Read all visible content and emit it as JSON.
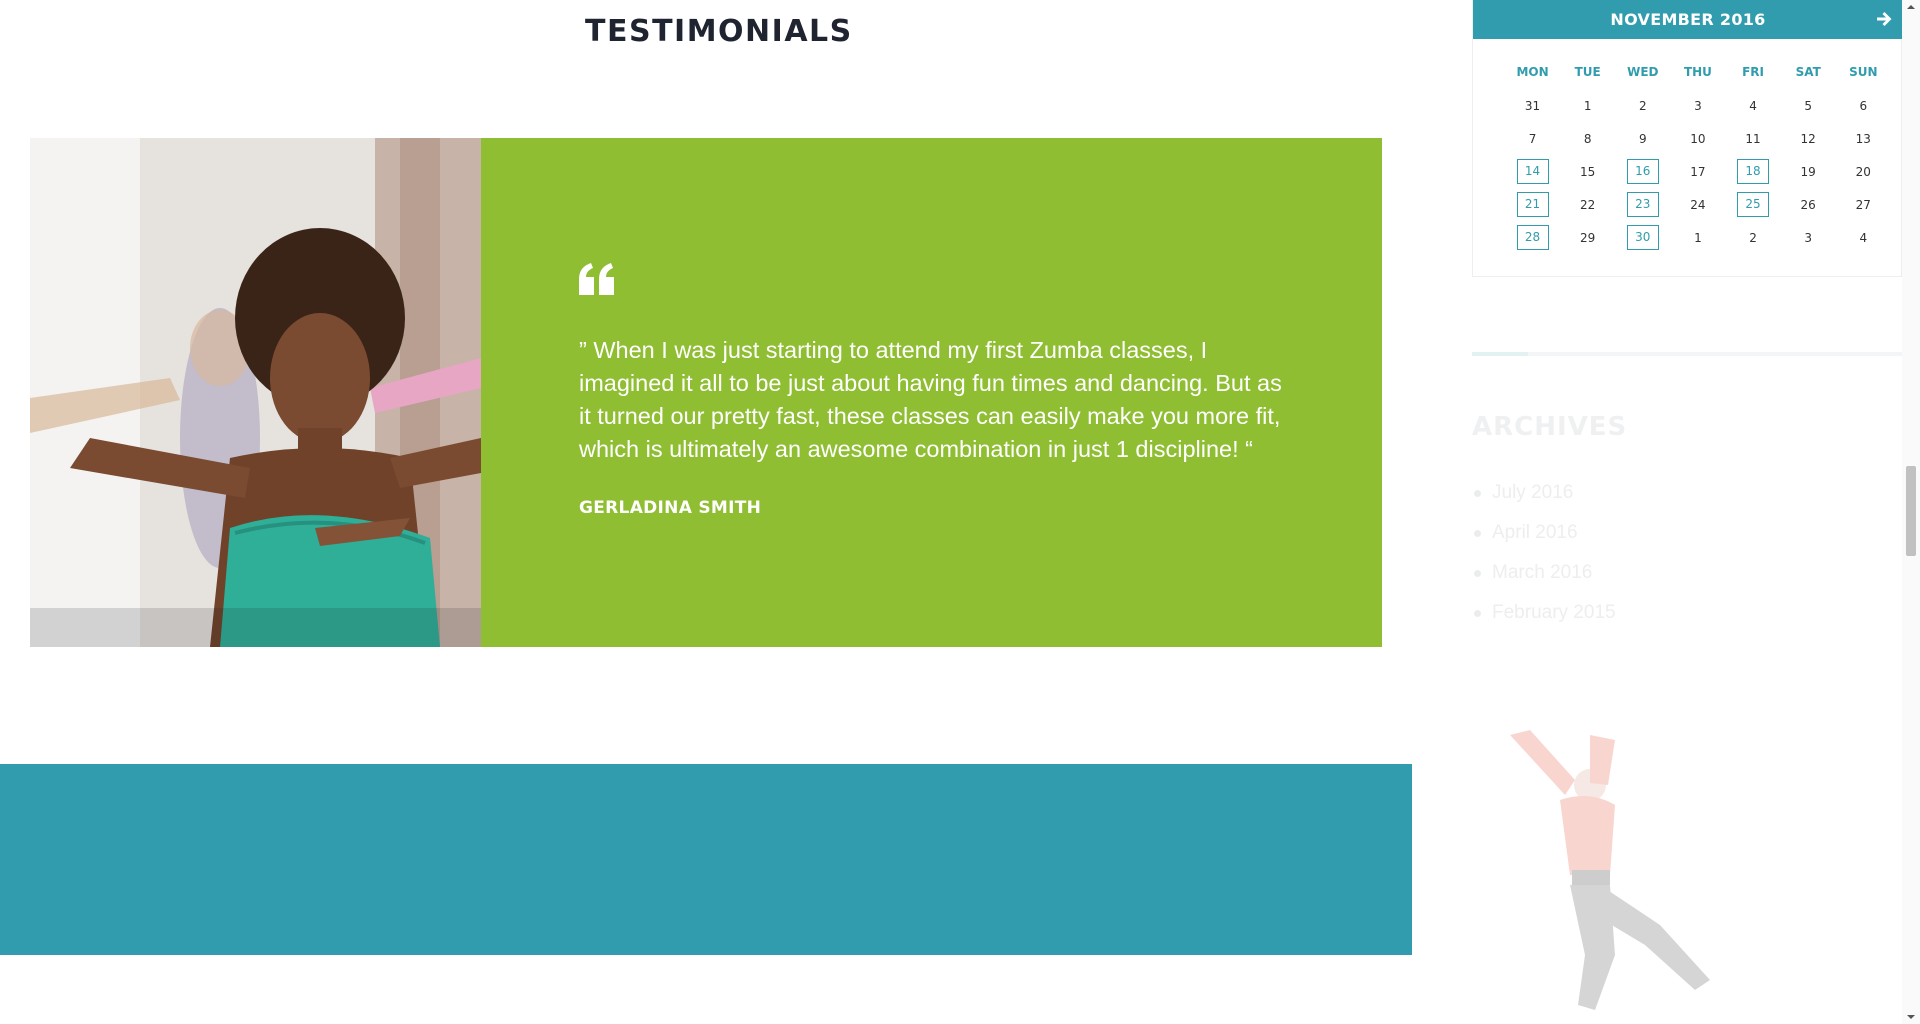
{
  "section": {
    "title": "TESTIMONIALS"
  },
  "testimonial": {
    "quote": "” When I was just starting to attend my first Zumba classes, I imagined it all to be just about having fun times and dancing. But as it turned our pretty fast, these classes can easily make you more fit, which is ultimately an awesome combination in just 1 discipline! “",
    "author": "GERLADINA SMITH",
    "panel_color": "#8fbe33",
    "quote_icon": "quote-icon"
  },
  "calendar": {
    "title": "NOVEMBER 2016",
    "next_icon": "arrow-right-icon",
    "accent_color": "#319cad",
    "weekdays": [
      "MON",
      "TUE",
      "WED",
      "THU",
      "FRI",
      "SAT",
      "SUN"
    ],
    "weeks": [
      [
        {
          "d": "31",
          "link": false
        },
        {
          "d": "1",
          "link": false
        },
        {
          "d": "2",
          "link": false
        },
        {
          "d": "3",
          "link": false
        },
        {
          "d": "4",
          "link": false
        },
        {
          "d": "5",
          "link": false
        },
        {
          "d": "6",
          "link": false
        }
      ],
      [
        {
          "d": "7",
          "link": false
        },
        {
          "d": "8",
          "link": false
        },
        {
          "d": "9",
          "link": false
        },
        {
          "d": "10",
          "link": false
        },
        {
          "d": "11",
          "link": false
        },
        {
          "d": "12",
          "link": false
        },
        {
          "d": "13",
          "link": false
        }
      ],
      [
        {
          "d": "14",
          "link": true
        },
        {
          "d": "15",
          "link": false
        },
        {
          "d": "16",
          "link": true
        },
        {
          "d": "17",
          "link": false
        },
        {
          "d": "18",
          "link": true
        },
        {
          "d": "19",
          "link": false
        },
        {
          "d": "20",
          "link": false
        }
      ],
      [
        {
          "d": "21",
          "link": true
        },
        {
          "d": "22",
          "link": false
        },
        {
          "d": "23",
          "link": true
        },
        {
          "d": "24",
          "link": false
        },
        {
          "d": "25",
          "link": true
        },
        {
          "d": "26",
          "link": false
        },
        {
          "d": "27",
          "link": false
        }
      ],
      [
        {
          "d": "28",
          "link": true
        },
        {
          "d": "29",
          "link": false
        },
        {
          "d": "30",
          "link": true
        },
        {
          "d": "1",
          "link": false
        },
        {
          "d": "2",
          "link": false
        },
        {
          "d": "3",
          "link": false
        },
        {
          "d": "4",
          "link": false
        }
      ]
    ]
  },
  "archives": {
    "title": "ARCHIVES",
    "items": [
      "July 2016",
      "April 2016",
      "March 2016",
      "February 2015"
    ]
  },
  "band": {
    "color": "#319cad"
  }
}
